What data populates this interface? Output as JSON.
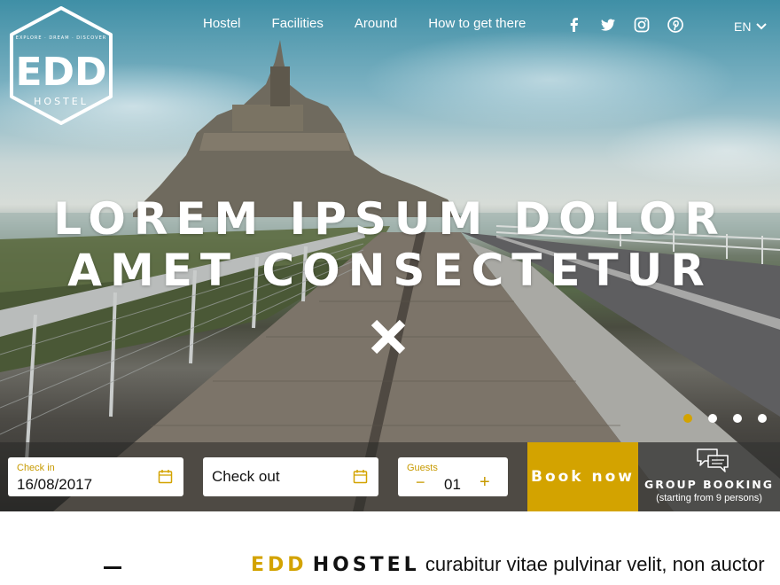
{
  "nav": {
    "items": [
      "Hostel",
      "Facilities",
      "Around",
      "How to get there"
    ],
    "social": [
      "facebook-icon",
      "twitter-icon",
      "instagram-icon",
      "pinterest-icon"
    ],
    "language": "EN"
  },
  "logo": {
    "text": "EDD",
    "top_text": "EXPLORE · DREAM · DISCOVER",
    "bottom_text": "HOSTEL"
  },
  "hero": {
    "line1": "Lorem ipsum dolor",
    "line2": "amet consectetur",
    "slides_total": 4,
    "slide_active": 1
  },
  "booking": {
    "checkin_label": "Check in",
    "checkin_value": "16/08/2017",
    "checkout_placeholder": "Check out",
    "guests_label": "Guests",
    "guests_value": "01",
    "guests_minus": "−",
    "guests_plus": "+",
    "book_now": "Book now",
    "group_title": "Group booking",
    "group_sub": "(starting from 9 persons)"
  },
  "intro": {
    "brand1": "EDD",
    "brand2": "HOSTEL",
    "text": "curabitur vitae pulvinar velit, non auctor"
  },
  "colors": {
    "accent": "#d3a300",
    "text": "#111111"
  }
}
